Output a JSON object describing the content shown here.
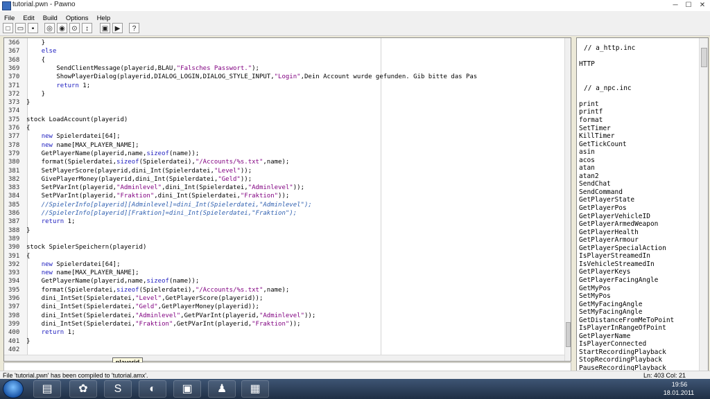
{
  "window": {
    "title": "tutorial.pwn - Pawno"
  },
  "menu": [
    "File",
    "Edit",
    "Build",
    "Options",
    "Help"
  ],
  "toolbar_icons": [
    "new-file-icon",
    "open-file-icon",
    "save-file-icon",
    "find-icon",
    "find-next-icon",
    "replace-icon",
    "goto-icon",
    "compile-options-icon",
    "compile-icon",
    "run-icon",
    "help-icon"
  ],
  "editor": {
    "lines": [
      {
        "num": "366",
        "text": "\t}"
      },
      {
        "num": "367",
        "text": "\telse"
      },
      {
        "num": "368",
        "text": "\t{"
      },
      {
        "num": "369",
        "text": "\t\tSendClientMessage(playerid,BLAU,\"Falsches Passwort.\");"
      },
      {
        "num": "370",
        "text": "\t\tShowPlayerDialog(playerid,DIALOG_LOGIN,DIALOG_STYLE_INPUT,\"Login\",\"Dein Account wurde gefunden. Gib bitte das Pas"
      },
      {
        "num": "371",
        "text": "\t\treturn 1;"
      },
      {
        "num": "372",
        "text": "\t}"
      },
      {
        "num": "373",
        "text": "}"
      },
      {
        "num": "374",
        "text": ""
      },
      {
        "num": "375",
        "text": "stock LoadAccount(playerid)"
      },
      {
        "num": "376",
        "text": "{"
      },
      {
        "num": "377",
        "text": "\tnew Spielerdatei[64];"
      },
      {
        "num": "378",
        "text": "\tnew name[MAX_PLAYER_NAME];"
      },
      {
        "num": "379",
        "text": "\tGetPlayerName(playerid,name,sizeof(name));"
      },
      {
        "num": "380",
        "text": "\tformat(Spielerdatei,sizeof(Spielerdatei),\"/Accounts/%s.txt\",name);"
      },
      {
        "num": "381",
        "text": "\tSetPlayerScore(playerid,dini_Int(Spielerdatei,\"Level\"));"
      },
      {
        "num": "382",
        "text": "\tGivePlayerMoney(playerid,dini_Int(Spielerdatei,\"Geld\"));"
      },
      {
        "num": "383",
        "text": "\tSetPVarInt(playerid,\"Adminlevel\",dini_Int(Spielerdatei,\"Adminlevel\"));"
      },
      {
        "num": "384",
        "text": "\tSetPVarInt(playerid,\"Fraktion\",dini_Int(Spielerdatei,\"Fraktion\"));"
      },
      {
        "num": "385",
        "text": "\t//SpielerInfo[playerid][Adminlevel]=dini_Int(Spielerdatei,\"Adminlevel\");"
      },
      {
        "num": "386",
        "text": "\t//SpielerInfo[playerid][Fraktion]=dini_Int(Spielerdatei,\"Fraktion\");"
      },
      {
        "num": "387",
        "text": "\treturn 1;"
      },
      {
        "num": "388",
        "text": "}"
      },
      {
        "num": "389",
        "text": ""
      },
      {
        "num": "390",
        "text": "stock SpielerSpeichern(playerid)"
      },
      {
        "num": "391",
        "text": "{"
      },
      {
        "num": "392",
        "text": "\tnew Spielerdatei[64];"
      },
      {
        "num": "393",
        "text": "\tnew name[MAX_PLAYER_NAME];"
      },
      {
        "num": "394",
        "text": "\tGetPlayerName(playerid,name,sizeof(name));"
      },
      {
        "num": "395",
        "text": "\tformat(Spielerdatei,sizeof(Spielerdatei),\"/Accounts/%s.txt\",name);"
      },
      {
        "num": "396",
        "text": "\tdini_IntSet(Spielerdatei,\"Level\",GetPlayerScore(playerid));"
      },
      {
        "num": "397",
        "text": "\tdini_IntSet(Spielerdatei,\"Geld\",GetPlayerMoney(playerid));"
      },
      {
        "num": "398",
        "text": "\tdini_IntSet(Spielerdatei,\"Adminlevel\",GetPVarInt(playerid,\"Adminlevel\"));"
      },
      {
        "num": "399",
        "text": "\tdini_IntSet(Spielerdatei,\"Fraktion\",GetPVarInt(playerid,\"Fraktion\"));"
      },
      {
        "num": "400",
        "text": "\treturn 1;"
      },
      {
        "num": "401",
        "text": "}"
      },
      {
        "num": "402",
        "text": ""
      },
      {
        "num": "403",
        "text": "stock isPlayerAdmin("
      }
    ],
    "tooltip": "playerid"
  },
  "sidebar": {
    "items": [
      "// a_http.inc",
      "",
      "HTTP",
      "",
      "",
      "// a_npc.inc",
      "",
      "print",
      "printf",
      "format",
      "SetTimer",
      "KillTimer",
      "GetTickCount",
      "asin",
      "acos",
      "atan",
      "atan2",
      "SendChat",
      "SendCommand",
      "GetPlayerState",
      "GetPlayerPos",
      "GetPlayerVehicleID",
      "GetPlayerArmedWeapon",
      "GetPlayerHealth",
      "GetPlayerArmour",
      "GetPlayerSpecialAction",
      "IsPlayerStreamedIn",
      "IsVehicleStreamedIn",
      "GetPlayerKeys",
      "GetPlayerFacingAngle",
      "GetMyPos",
      "SetMyPos",
      "GetMyFacingAngle",
      "SetMyFacingAngle",
      "GetDistanceFromMeToPoint",
      "IsPlayerInRangeOfPoint",
      "GetPlayerName",
      "IsPlayerConnected",
      "StartRecordingPlayback",
      "StopRecordingPlayback",
      "PauseRecordingPlayback"
    ]
  },
  "status": {
    "message": "File 'tutorial.pwn' has been compiled to 'tutorial.amx'.",
    "position": "Ln: 403   Col: 21"
  },
  "taskbar": {
    "time": "19:56",
    "date": "18.01.2011",
    "apps": [
      "explorer",
      "icq",
      "skype",
      "firefox",
      "media",
      "pawno",
      "terminal"
    ]
  }
}
